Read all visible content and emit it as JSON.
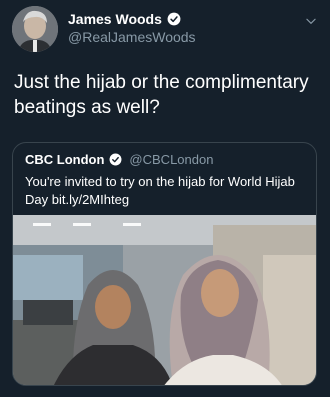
{
  "tweet": {
    "author": {
      "display_name": "James Woods",
      "handle": "@RealJamesWoods",
      "verified": true
    },
    "text": "Just the hijab or the complimentary beatings as well?",
    "icons": {
      "verified": "verified-badge-icon",
      "menu": "chevron-down-icon"
    }
  },
  "quoted_tweet": {
    "author": {
      "display_name": "CBC London",
      "handle": "@CBCLondon",
      "verified": true
    },
    "text": "You're invited to try on the hijab for World Hijab Day bit.ly/2MIhteg"
  },
  "colors": {
    "background": "#15202b",
    "text": "#ffffff",
    "secondary_text": "#8899a6",
    "border": "#38444d",
    "verified": "#ffffff"
  }
}
